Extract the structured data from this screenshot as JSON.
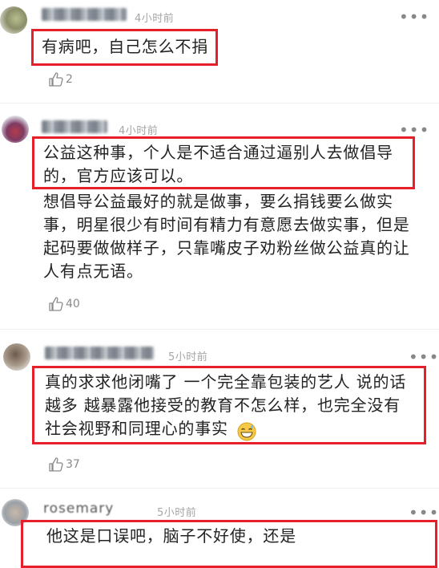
{
  "comments": [
    {
      "timestamp": "4小时前",
      "highlighted_text": "有病吧，自己怎么不捐",
      "extra_text": "",
      "likes": "2",
      "emoji": ""
    },
    {
      "timestamp": "4小时前",
      "highlighted_text": "公益这种事，个人是不适合通过逼别人去做倡导\n的，官方应该可以。",
      "extra_text": "想倡导公益最好的就是做事，要么捐钱要么做实\n事，明星很少有时间有精力有意愿去做实事，但是\n起码要做做样子，只靠嘴皮子劝粉丝做公益真的让\n人有点无语。",
      "likes": "40",
      "emoji": ""
    },
    {
      "timestamp": "5小时前",
      "highlighted_text": "真的求求他闭嘴了 一个完全靠包装的艺人 说的话\n越多 越暴露他接受的教育不怎么样，也完全没有\n社会视野和同理心的事实",
      "extra_text": "",
      "likes": "37",
      "emoji": "grinning-sweat-emoji"
    },
    {
      "timestamp": "5小时前",
      "username_partial": "rosemary",
      "highlighted_text": "他这是口误吧，脑子不好使，还是",
      "extra_text": "",
      "likes": "",
      "emoji": ""
    }
  ],
  "icons": {
    "like": "thumbs-up-icon",
    "more": "more-options-icon"
  },
  "colors": {
    "highlight_border": "#e5202b",
    "timestamp": "#a5a5a5",
    "text": "#232323"
  }
}
